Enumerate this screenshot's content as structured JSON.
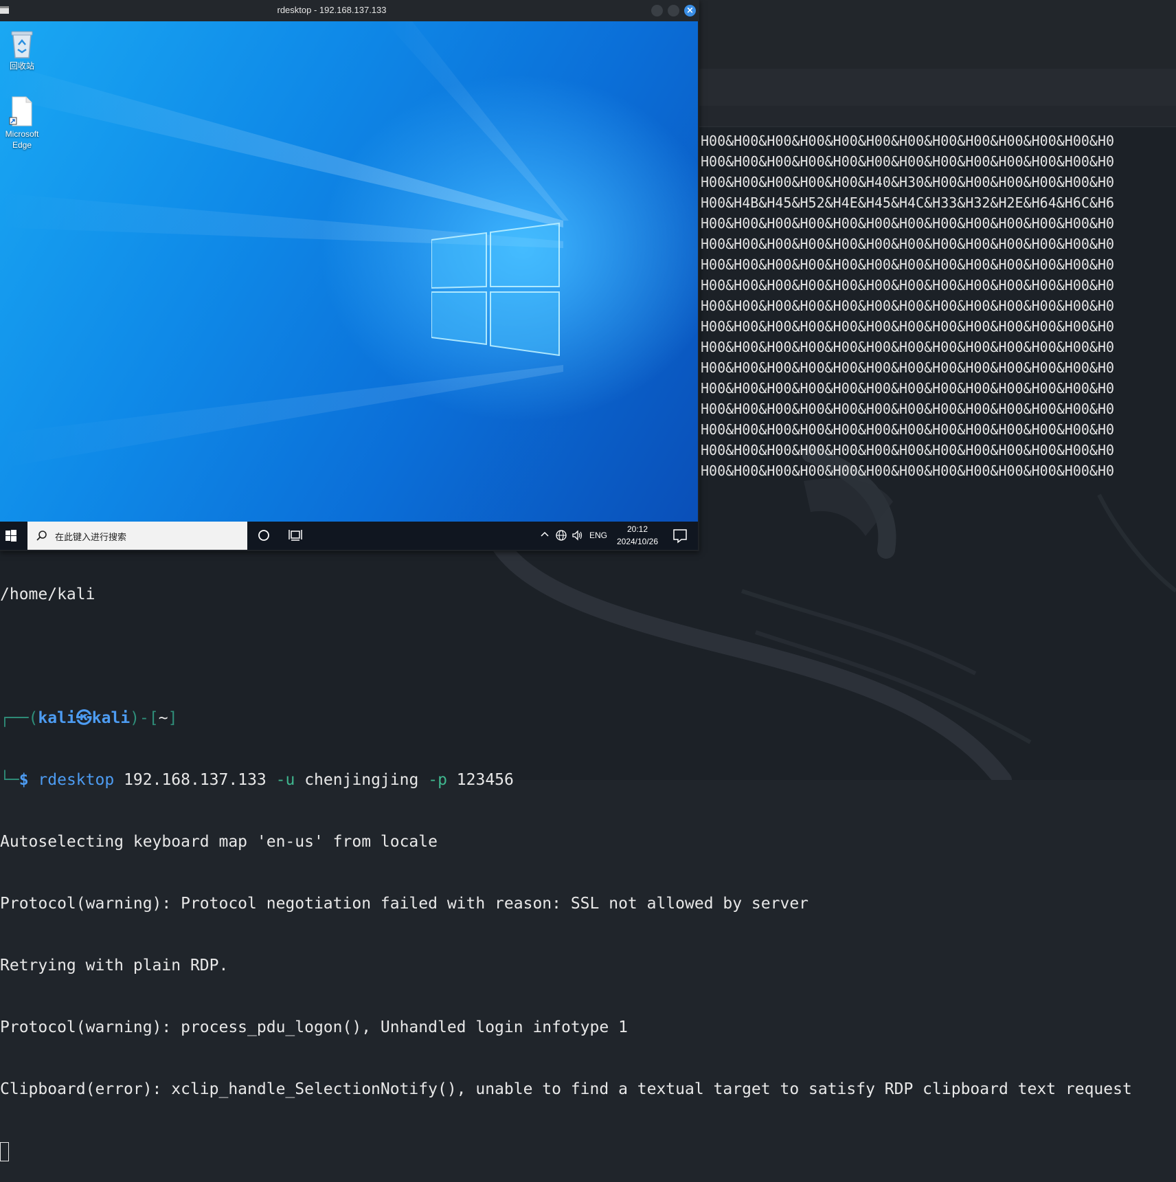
{
  "rdp_window": {
    "title": "rdesktop - 192.168.137.133",
    "close_glyph": "×"
  },
  "desktop": {
    "icons": [
      {
        "label": "回收站",
        "icon": "recycle-bin-icon"
      },
      {
        "label": "Microsoft Edge",
        "icon": "edge-shortcut-icon"
      }
    ]
  },
  "taskbar": {
    "search_placeholder": "在此键入进行搜索",
    "language": "ENG",
    "time": "20:12",
    "date": "2024/10/26",
    "tray_icons": [
      "chevron-up-icon",
      "network-globe-icon",
      "volume-icon"
    ]
  },
  "hex_output": {
    "lines": [
      "H00&H00&H00&H00&H00&H00&H00&H00&H00&H00&H00&H00&H0",
      "H00&H00&H00&H00&H00&H00&H00&H00&H00&H00&H00&H00&H0",
      "H00&H00&H00&H00&H00&H40&H30&H00&H00&H00&H00&H00&H0",
      "H00&H4B&H45&H52&H4E&H45&H4C&H33&H32&H2E&H64&H6C&H6",
      "H00&H00&H00&H00&H00&H00&H00&H00&H00&H00&H00&H00&H0",
      "H00&H00&H00&H00&H00&H00&H00&H00&H00&H00&H00&H00&H0",
      "H00&H00&H00&H00&H00&H00&H00&H00&H00&H00&H00&H00&H0",
      "H00&H00&H00&H00&H00&H00&H00&H00&H00&H00&H00&H00&H0",
      "H00&H00&H00&H00&H00&H00&H00&H00&H00&H00&H00&H00&H0",
      "H00&H00&H00&H00&H00&H00&H00&H00&H00&H00&H00&H00&H0",
      "H00&H00&H00&H00&H00&H00&H00&H00&H00&H00&H00&H00&H0",
      "H00&H00&H00&H00&H00&H00&H00&H00&H00&H00&H00&H00&H0",
      "H00&H00&H00&H00&H00&H00&H00&H00&H00&H00&H00&H00&H0",
      "H00&H00&H00&H00&H00&H00&H00&H00&H00&H00&H00&H00&H0",
      "H00&H00&H00&H00&H00&H00&H00&H00&H00&H00&H00&H00&H0",
      "H00&H00&H00&H00&H00&H00&H00&H00&H00&H00&H00&H00&H0",
      "H00&H00&H00&H00&H00&H00&H00&H00&H00&H00&H00&H00&H0"
    ]
  },
  "terminal": {
    "pwd_output": "/home/kali",
    "prompt": {
      "corner_top": "┌──(",
      "user": "kali",
      "at_symbol": "㉿",
      "host": "kali",
      "dir_open": ")-[",
      "dir": "~",
      "dir_close": "]",
      "corner_bottom": "└─",
      "dollar": "$"
    },
    "command": {
      "program": "rdesktop",
      "host": "192.168.137.133",
      "flag_u": "-u",
      "user": "chenjingjing",
      "flag_p": "-p",
      "password": "123456"
    },
    "output": [
      "Autoselecting keyboard map 'en-us' from locale",
      "Protocol(warning): Protocol negotiation failed with reason: SSL not allowed by server",
      "Retrying with plain RDP.",
      "Protocol(warning): process_pdu_logon(), Unhandled login infotype 1",
      "Clipboard(error): xclip_handle_SelectionNotify(), unable to find a textual target to satisfy RDP clipboard text request"
    ]
  }
}
